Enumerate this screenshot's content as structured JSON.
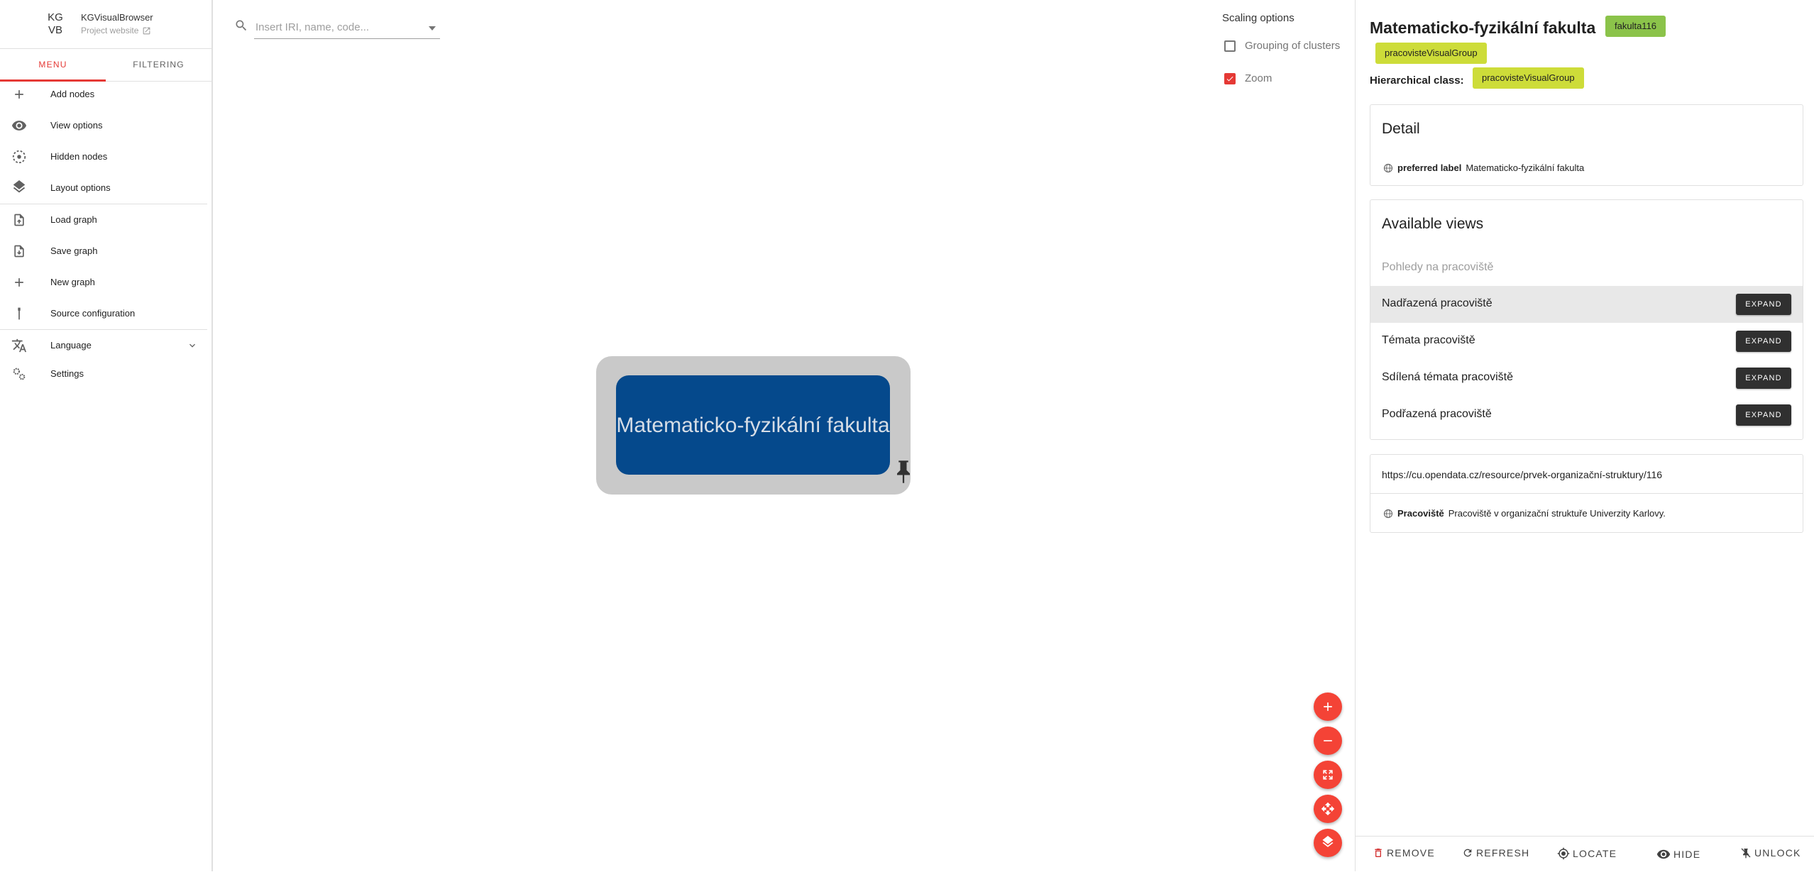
{
  "app": {
    "logo_line1": "KG",
    "logo_line2": "VB",
    "title": "KGVisualBrowser",
    "project_link": "Project website"
  },
  "tabs": {
    "menu": "MENU",
    "filtering": "FILTERING"
  },
  "menu": {
    "add_nodes": "Add nodes",
    "view_options": "View options",
    "hidden_nodes": "Hidden nodes",
    "layout_options": "Layout options",
    "load_graph": "Load graph",
    "save_graph": "Save graph",
    "new_graph": "New graph",
    "source_configuration": "Source configuration",
    "language": "Language",
    "settings": "Settings"
  },
  "search": {
    "placeholder": "Insert IRI, name, code..."
  },
  "scaling": {
    "title": "Scaling options",
    "grouping_label": "Grouping of clusters",
    "grouping_checked": false,
    "zoom_label": "Zoom",
    "zoom_checked": true
  },
  "graph": {
    "node_label": "Matematicko-fyzikální fakulta",
    "node_color": "#05498c",
    "cluster_color": "#c9c9c9"
  },
  "detail_panel": {
    "title": "Matematicko-fyzikální fakulta",
    "tag_id": "fakulta116",
    "tag_id_color": "#8bc34a",
    "tag_group": "pracovisteVisualGroup",
    "tag_group_color": "#cddc39",
    "hierarchical_label": "Hierarchical class:",
    "hierarchical_value": "pracovisteVisualGroup",
    "detail": {
      "heading": "Detail",
      "prop_name": "preferred label",
      "prop_value": "Matematicko-fyzikální fakulta"
    },
    "views": {
      "heading": "Available views",
      "subheading": "Pohledy na pracoviště",
      "expand_label": "EXPAND",
      "items": [
        {
          "label": "Nadřazená pracoviště"
        },
        {
          "label": "Témata pracoviště"
        },
        {
          "label": "Sdílená témata pracoviště"
        },
        {
          "label": "Podřazená pracoviště"
        }
      ]
    },
    "iri": "https://cu.opendata.cz/resource/prvek-organizační-struktury/116",
    "class_name": "Pracoviště",
    "class_desc": "Pracoviště v organizační struktuře Univerzity Karlovy."
  },
  "actions": {
    "remove": "REMOVE",
    "refresh": "REFRESH",
    "locate": "LOCATE",
    "hide": "HIDE",
    "unlock": "UNLOCK"
  },
  "colors": {
    "accent": "#f44336",
    "tab_active": "#e53935"
  }
}
